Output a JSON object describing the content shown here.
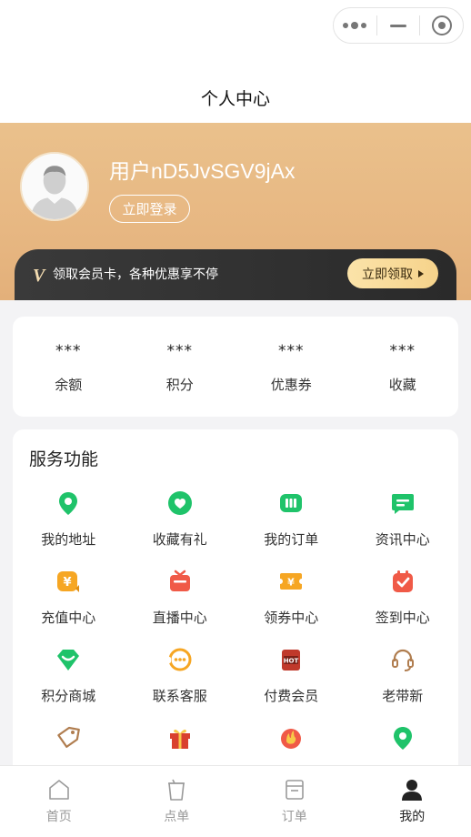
{
  "header": {
    "title": "个人中心"
  },
  "profile": {
    "username": "用户nD5JvSGV9jAx",
    "login_label": "立即登录"
  },
  "vip": {
    "logo": "V",
    "text": "领取会员卡，各种优惠享不停",
    "button_label": "立即领取"
  },
  "stats": [
    {
      "value": "***",
      "label": "余额"
    },
    {
      "value": "***",
      "label": "积分"
    },
    {
      "value": "***",
      "label": "优惠券"
    },
    {
      "value": "***",
      "label": "收藏"
    }
  ],
  "services": {
    "title": "服务功能",
    "items": [
      {
        "label": "我的地址",
        "icon": "location-pin-icon",
        "color": "#1fc36a"
      },
      {
        "label": "收藏有礼",
        "icon": "heart-icon",
        "color": "#1fc36a"
      },
      {
        "label": "我的订单",
        "icon": "order-icon",
        "color": "#1fc36a"
      },
      {
        "label": "资讯中心",
        "icon": "message-icon",
        "color": "#1fc36a"
      },
      {
        "label": "充值中心",
        "icon": "recharge-icon",
        "color": "#f6a623"
      },
      {
        "label": "直播中心",
        "icon": "live-icon",
        "color": "#f05a47"
      },
      {
        "label": "领券中心",
        "icon": "coupon-icon",
        "color": "#f6a623"
      },
      {
        "label": "签到中心",
        "icon": "checkin-icon",
        "color": "#f05a47"
      },
      {
        "label": "积分商城",
        "icon": "points-mall-icon",
        "color": "#1fc36a"
      },
      {
        "label": "联系客服",
        "icon": "customer-service-icon",
        "color": "#f6a623"
      },
      {
        "label": "付费会员",
        "icon": "hot-member-icon",
        "color": "#c0392b"
      },
      {
        "label": "老带新",
        "icon": "headset-icon",
        "color": "#b07d4f"
      },
      {
        "label": "",
        "icon": "tag-icon",
        "color": "#b07d4f"
      },
      {
        "label": "",
        "icon": "gift-icon",
        "color": "#d9412f"
      },
      {
        "label": "",
        "icon": "bargain-icon",
        "color": "#f05a47"
      },
      {
        "label": "",
        "icon": "store-location-icon",
        "color": "#1fc36a"
      }
    ]
  },
  "tabbar": [
    {
      "label": "首页",
      "icon": "home-icon",
      "active": false
    },
    {
      "label": "点单",
      "icon": "cup-icon",
      "active": false
    },
    {
      "label": "订单",
      "icon": "order-list-icon",
      "active": false
    },
    {
      "label": "我的",
      "icon": "user-icon",
      "active": true
    }
  ]
}
